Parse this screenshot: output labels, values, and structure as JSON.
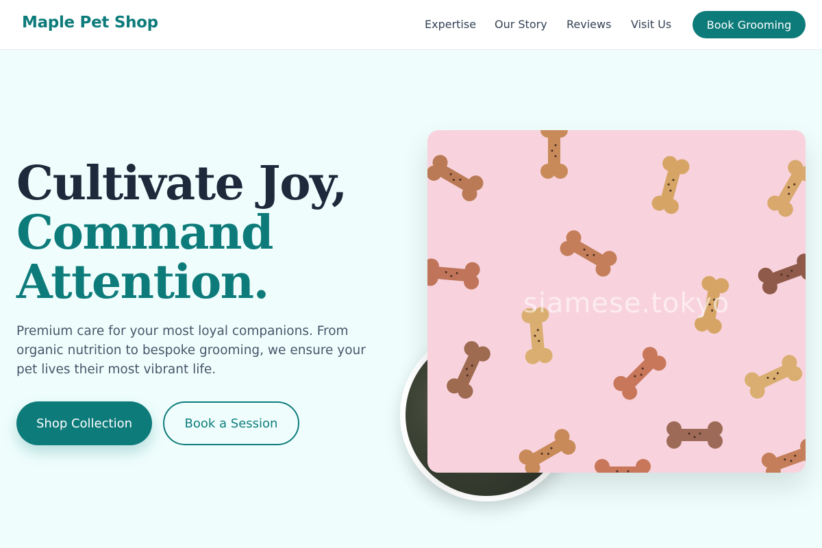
{
  "header": {
    "brand": "Maple Pet Shop",
    "nav": [
      "Expertise",
      "Our Story",
      "Reviews",
      "Visit Us"
    ],
    "cta": "Book Grooming"
  },
  "hero": {
    "headline_line1": "Cultivate Joy,",
    "headline_line2": "Command",
    "headline_line3": "Attention.",
    "lede": "Premium care for your most loyal companions. From organic nutrition to bespoke grooming, we ensure your pet lives their most vibrant life.",
    "primary_cta": "Shop Collection",
    "secondary_cta": "Book a Session",
    "image_watermark": "siamese.tokyo"
  },
  "colors": {
    "accent": "#0e7b7b",
    "background": "#effefd",
    "heading": "#1e293b",
    "photo_bg": "#f8d3dd"
  },
  "icons": {
    "main_photo": "dog-bone-treats-photo",
    "circle_photo": "cat-photo"
  }
}
